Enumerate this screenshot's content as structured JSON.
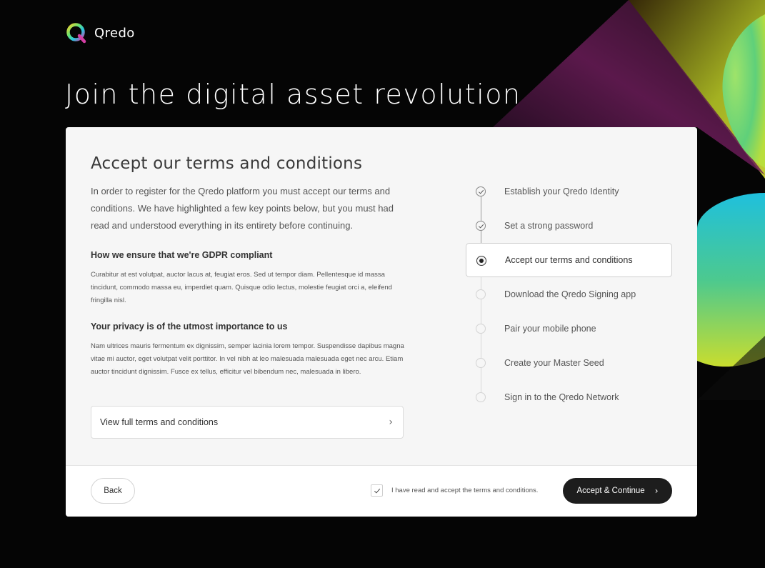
{
  "brand": {
    "name": "Qredo"
  },
  "hero": {
    "title": "Join the digital asset revolution"
  },
  "terms": {
    "heading": "Accept our terms and conditions",
    "intro": "In order to register for the Qredo platform you must accept our terms and conditions. We have highlighted a few key points below, but you must had read and understood everything in its entirety before continuing.",
    "sections": [
      {
        "title": "How we ensure that we're GDPR compliant",
        "text": "Curabitur at est volutpat, auctor lacus at, feugiat eros. Sed ut tempor diam. Pellentesque id massa tincidunt, commodo massa eu, imperdiet quam. Quisque odio lectus, molestie feugiat orci a, eleifend fringilla nisl."
      },
      {
        "title": "Your privacy is of the utmost importance to us",
        "text": "Nam ultrices mauris fermentum ex dignissim, semper lacinia lorem tempor. Suspendisse dapibus magna vitae mi auctor, eget volutpat velit porttitor. In vel nibh at leo malesuada malesuada eget nec arcu. Etiam auctor tincidunt dignissim. Fusce ex tellus, efficitur vel bibendum nec, malesuada in libero."
      }
    ],
    "view_full_label": "View full terms and conditions"
  },
  "steps": [
    {
      "label": "Establish your Qredo Identity",
      "state": "done"
    },
    {
      "label": "Set a strong password",
      "state": "done"
    },
    {
      "label": "Accept our terms and conditions",
      "state": "active"
    },
    {
      "label": "Download the Qredo Signing app",
      "state": "todo"
    },
    {
      "label": "Pair your mobile phone",
      "state": "todo"
    },
    {
      "label": "Create your Master Seed",
      "state": "todo"
    },
    {
      "label": "Sign in to the Qredo Network",
      "state": "todo"
    }
  ],
  "footer": {
    "back_label": "Back",
    "accept_label": "I have read and accept the terms and conditions.",
    "accept_checked": true,
    "continue_label": "Accept & Continue"
  },
  "colors": {
    "background": "#050505",
    "card": "#f6f6f6",
    "primary_button": "#1d1d1d",
    "accent_green": "#7ed957",
    "accent_cyan": "#22c3d6",
    "accent_yellow": "#c8e03a",
    "accent_magenta": "#b8328c"
  }
}
